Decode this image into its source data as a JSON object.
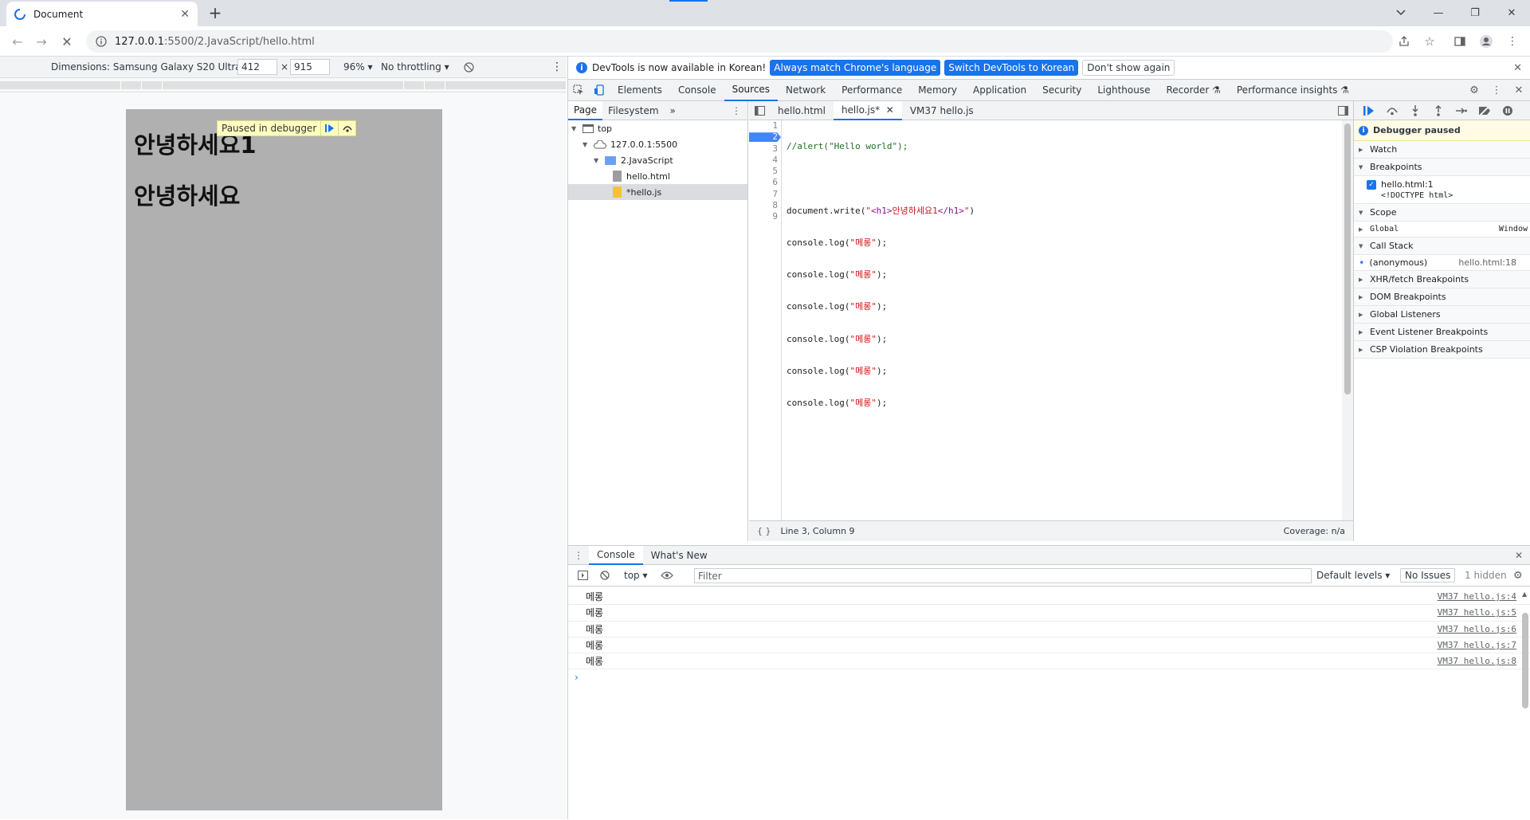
{
  "browser": {
    "tab_title": "Document",
    "tab_close": "✕",
    "new_tab": "+",
    "url_host": "127.0.0.1",
    "url_path": ":5500/2.JavaScript/hello.html",
    "accent_color": "#1a73e8"
  },
  "device_toolbar": {
    "dimensions_label": "Dimensions: Samsung Galaxy S20 Ultra",
    "width": "412",
    "times": "×",
    "height": "915",
    "zoom": "96%",
    "throttling": "No throttling"
  },
  "page": {
    "heading1": "안녕하세요1",
    "heading2": "안녕하세요",
    "paused_label": "Paused in debugger"
  },
  "devtools": {
    "infobar": {
      "message": "DevTools is now available in Korean!",
      "btn_match": "Always match Chrome's language",
      "btn_switch": "Switch DevTools to Korean",
      "btn_dismiss": "Don't show again"
    },
    "tabs": [
      "Elements",
      "Console",
      "Sources",
      "Network",
      "Performance",
      "Memory",
      "Application",
      "Security",
      "Lighthouse",
      "Recorder",
      "Performance insights"
    ],
    "navigator": {
      "tabs": [
        "Page",
        "Filesystem"
      ],
      "tree": [
        "top",
        "127.0.0.1:5500",
        "2.JavaScript",
        "hello.html",
        "*hello.js"
      ]
    },
    "editor": {
      "tabs": [
        "hello.html",
        "hello.js*",
        "VM37 hello.js"
      ],
      "line_numbers": [
        "1",
        "2",
        "3",
        "4",
        "5",
        "6",
        "7",
        "8",
        "9"
      ],
      "lines": [
        "//alert(\"Hello world\");",
        "",
        "document.write(\"<h1>안녕하세요1</h1>\")",
        "console.log(\"메롱\");",
        "console.log(\"메롱\");",
        "console.log(\"메롱\");",
        "console.log(\"메롱\");",
        "console.log(\"메롱\");",
        "console.log(\"메롱\");"
      ],
      "status": "Line 3, Column 9",
      "coverage": "Coverage: n/a"
    },
    "debugger": {
      "paused": "Debugger paused",
      "watch": "Watch",
      "breakpoints": "Breakpoints",
      "bp_file": "hello.html:1",
      "bp_code": "<!DOCTYPE html>",
      "scope": "Scope",
      "global": "Global",
      "global_value": "Window",
      "call_stack": "Call Stack",
      "frame_name": "(anonymous)",
      "frame_loc": "hello.html:18",
      "sections": [
        "XHR/fetch Breakpoints",
        "DOM Breakpoints",
        "Global Listeners",
        "Event Listener Breakpoints",
        "CSP Violation Breakpoints"
      ]
    },
    "drawer": {
      "tabs": [
        "Console",
        "What's New"
      ],
      "context": "top",
      "filter_placeholder": "Filter",
      "levels": "Default levels",
      "issues": "No Issues",
      "hidden": "1 hidden",
      "logs": [
        {
          "text": "메롱",
          "src": "VM37 hello.js:4"
        },
        {
          "text": "메롱",
          "src": "VM37 hello.js:5"
        },
        {
          "text": "메롱",
          "src": "VM37 hello.js:6"
        },
        {
          "text": "메롱",
          "src": "VM37 hello.js:7"
        },
        {
          "text": "메롱",
          "src": "VM37 hello.js:8"
        }
      ],
      "prompt": "›"
    }
  }
}
